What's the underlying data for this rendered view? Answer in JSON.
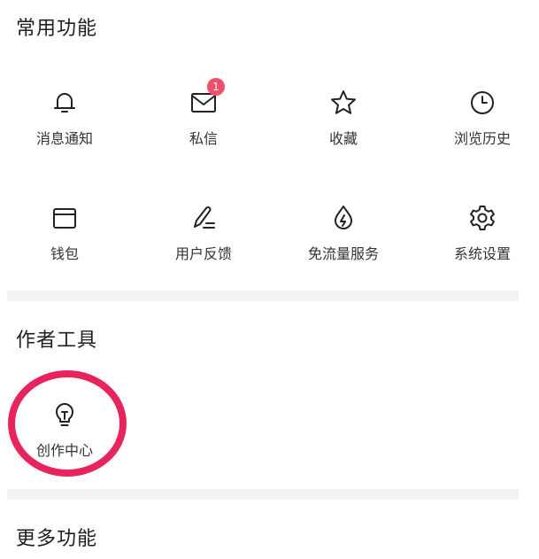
{
  "sections": {
    "common": {
      "title": "常用功能"
    },
    "author": {
      "title": "作者工具"
    },
    "more": {
      "title": "更多功能"
    }
  },
  "common_items": [
    {
      "label": "消息通知",
      "icon": "bell-icon"
    },
    {
      "label": "私信",
      "icon": "mail-icon",
      "badge": "1"
    },
    {
      "label": "收藏",
      "icon": "star-icon"
    },
    {
      "label": "浏览历史",
      "icon": "clock-icon"
    },
    {
      "label": "钱包",
      "icon": "wallet-icon"
    },
    {
      "label": "用户反馈",
      "icon": "pen-icon"
    },
    {
      "label": "免流量服务",
      "icon": "drop-bolt-icon"
    },
    {
      "label": "系统设置",
      "icon": "gear-icon"
    }
  ],
  "author_items": [
    {
      "label": "创作中心",
      "icon": "lightbulb-icon"
    }
  ],
  "colors": {
    "badge": "#f0506e",
    "highlight_ring": "#e8245e",
    "divider": "#f3f3f3",
    "icon_stroke": "#222222"
  }
}
